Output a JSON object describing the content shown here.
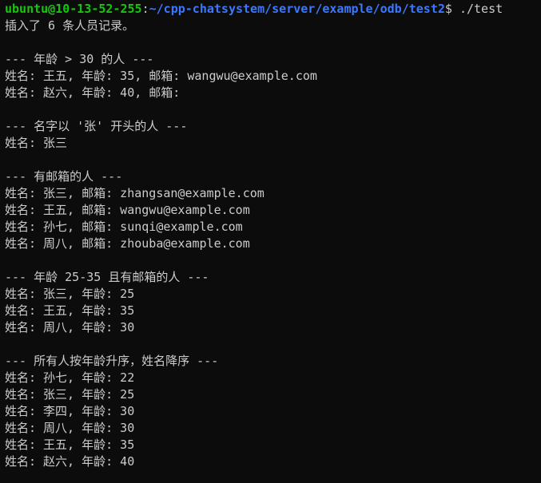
{
  "terminal": {
    "prompt": {
      "user_host": "ubuntu@10-13-52-255",
      "separator": ":",
      "path": "~/cpp-chatsystem/server/example/odb/test2",
      "symbol": "$",
      "command": " ./test"
    },
    "lines": [
      "插入了 6 条人员记录。",
      "",
      "--- 年龄 > 30 的人 ---",
      "姓名: 王五, 年龄: 35, 邮箱: wangwu@example.com",
      "姓名: 赵六, 年龄: 40, 邮箱:",
      "",
      "--- 名字以 '张' 开头的人 ---",
      "姓名: 张三",
      "",
      "--- 有邮箱的人 ---",
      "姓名: 张三, 邮箱: zhangsan@example.com",
      "姓名: 王五, 邮箱: wangwu@example.com",
      "姓名: 孙七, 邮箱: sunqi@example.com",
      "姓名: 周八, 邮箱: zhouba@example.com",
      "",
      "--- 年龄 25-35 且有邮箱的人 ---",
      "姓名: 张三, 年龄: 25",
      "姓名: 王五, 年龄: 35",
      "姓名: 周八, 年龄: 30",
      "",
      "--- 所有人按年龄升序，姓名降序 ---",
      "姓名: 孙七, 年龄: 22",
      "姓名: 张三, 年龄: 25",
      "姓名: 李四, 年龄: 30",
      "姓名: 周八, 年龄: 30",
      "姓名: 王五, 年龄: 35",
      "姓名: 赵六, 年龄: 40"
    ]
  },
  "colors": {
    "background": "#0c0c0c",
    "text": "#cccccc",
    "prompt_user": "#16c60c",
    "prompt_path": "#3b78ff"
  }
}
